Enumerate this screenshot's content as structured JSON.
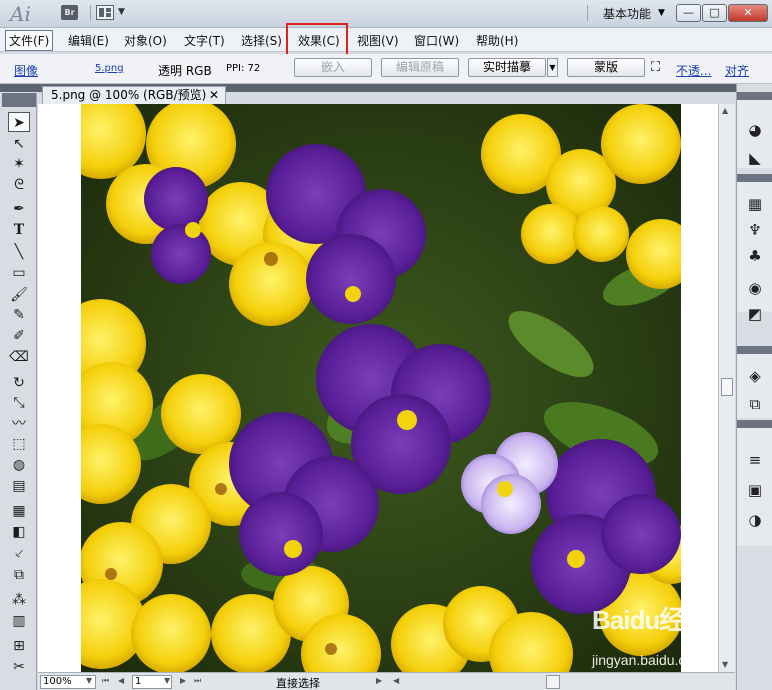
{
  "titlebar": {
    "app_logo": "Ai",
    "bridge_label": "Br",
    "workspace_label": "基本功能"
  },
  "menu": {
    "items": [
      "文件(F)",
      "编辑(E)",
      "对象(O)",
      "文字(T)",
      "选择(S)",
      "效果(C)",
      "视图(V)",
      "窗口(W)",
      "帮助(H)"
    ],
    "active_index": 0,
    "highlighted_index": 5
  },
  "control_bar": {
    "object_type": "图像",
    "file_link": "5.png",
    "transparency": "透明 RGB",
    "ppi": "PPI: 72",
    "embed_button": "嵌入",
    "edit_original_button": "编辑原稿",
    "live_trace_button": "实时描摹",
    "mask_button": "蒙版",
    "opacity_link": "不透...",
    "align_link": "对齐"
  },
  "document": {
    "tab_title": "5.png @ 100% (RGB/预览)",
    "close_glyph": "✕"
  },
  "status_bar": {
    "zoom": "100%",
    "artboard": "1",
    "current_tool": "直接选择"
  },
  "watermark": {
    "brand": "Baidu经验",
    "url": "jingyan.baidu.com"
  },
  "colors": {
    "highlight_box": "#e02020",
    "link": "#1b3fb0",
    "panel_dark": "#6b7480"
  },
  "icons": {
    "toolbox": [
      "selection-tool-icon",
      "direct-selection-tool-icon",
      "magic-wand-icon",
      "lasso-icon",
      "pen-tool-icon",
      "type-tool-icon",
      "line-tool-icon",
      "rectangle-tool-icon",
      "paintbrush-icon",
      "pencil-icon",
      "blob-brush-icon",
      "eraser-icon",
      "rotate-tool-icon",
      "scale-tool-icon",
      "warp-tool-icon",
      "free-transform-icon",
      "shape-builder-icon",
      "graph-tool-icon",
      "mesh-tool-icon",
      "gradient-tool-icon",
      "eyedropper-icon",
      "blend-tool-icon",
      "symbol-sprayer-icon",
      "column-graph-icon",
      "artboard-tool-icon",
      "slice-tool-icon"
    ],
    "dock": [
      "color-panel-icon",
      "color-guide-icon",
      "swatches-icon",
      "brushes-icon",
      "symbols-icon",
      "stroke-icon",
      "transparency-icon",
      "appearance-icon",
      "graphic-styles-icon",
      "layers-icon",
      "artboards-icon",
      "align-icon",
      "transform-icon",
      "pathfinder-icon"
    ]
  }
}
